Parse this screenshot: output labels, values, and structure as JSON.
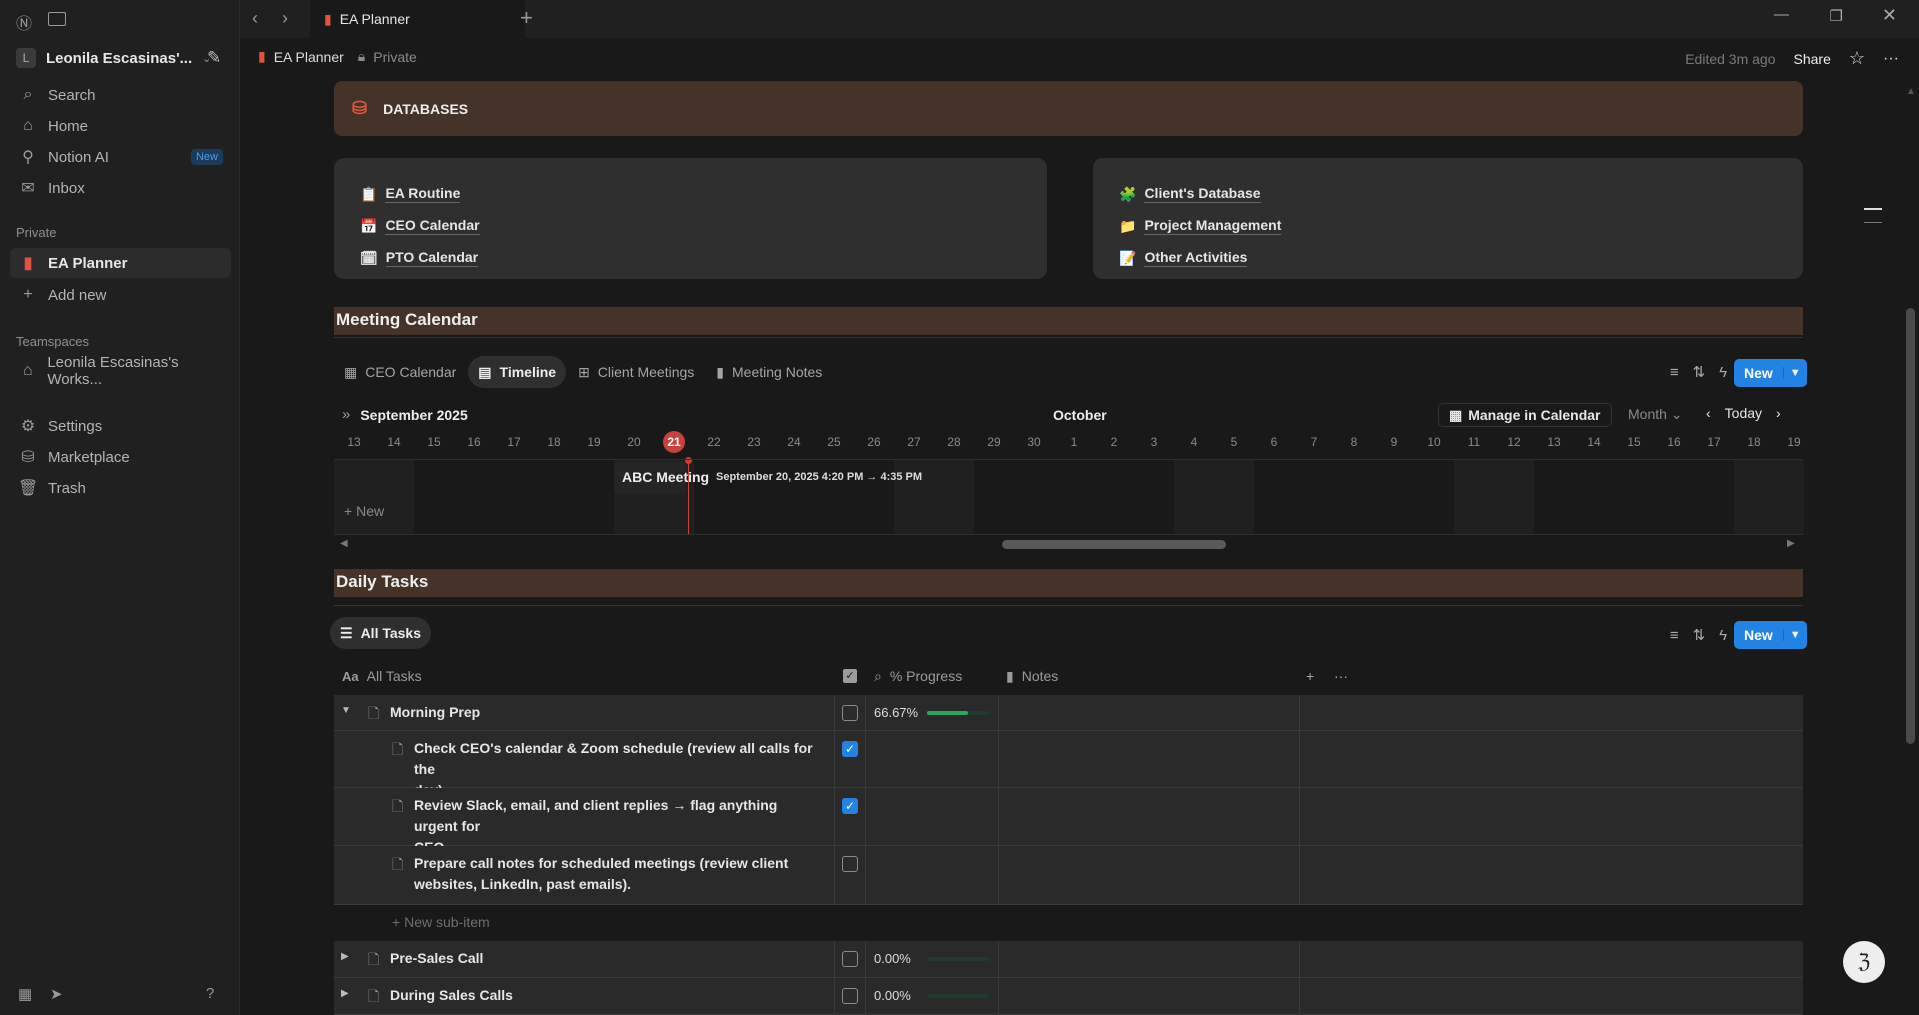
{
  "sidebar": {
    "workspace": "Leonila Escasinas'...",
    "workspace_initial": "L",
    "search": "Search",
    "home": "Home",
    "notion_ai": "Notion AI",
    "new_badge": "New",
    "inbox": "Inbox",
    "private_label": "Private",
    "ea_planner": "EA Planner",
    "add_new": "Add new",
    "teamspaces_label": "Teamspaces",
    "teamspace_item": "Leonila Escasinas's Works...",
    "settings": "Settings",
    "marketplace": "Marketplace",
    "trash": "Trash"
  },
  "tab": {
    "title": "EA Planner"
  },
  "topbar": {
    "breadcrumb": "EA Planner",
    "privacy": "Private",
    "edited": "Edited 3m ago",
    "share": "Share"
  },
  "databases": {
    "title": "DATABASES",
    "left": [
      "EA Routine",
      "CEO Calendar",
      "PTO Calendar"
    ],
    "right": [
      "Client's Database",
      "Project Management",
      "Other Activities"
    ]
  },
  "meeting": {
    "title": "Meeting Calendar",
    "tabs": [
      "CEO Calendar",
      "Timeline",
      "Client Meetings",
      "Meeting Notes"
    ],
    "new": "New",
    "month_label": "September 2025",
    "next_month": "October",
    "manage": "Manage in Calendar",
    "scale": "Month",
    "today": "Today",
    "dates": [
      "13",
      "14",
      "15",
      "16",
      "17",
      "18",
      "19",
      "20",
      "21",
      "22",
      "23",
      "24",
      "25",
      "26",
      "27",
      "28",
      "29",
      "30",
      "1",
      "2",
      "3",
      "4",
      "5",
      "6",
      "7",
      "8",
      "9",
      "10",
      "11",
      "12",
      "13",
      "14",
      "15",
      "16",
      "17",
      "18",
      "19"
    ],
    "today_index": 8,
    "event": {
      "title": "ABC Meeting",
      "time": "September 20, 2025 4:20 PM → 4:35 PM"
    },
    "add_new": "New"
  },
  "tasks": {
    "title": "Daily Tasks",
    "view": "All Tasks",
    "new": "New",
    "columns": {
      "title": "All Tasks",
      "progress": "% Progress",
      "notes": "Notes"
    },
    "rows": [
      {
        "title": "Morning Prep",
        "done": false,
        "progress": "66.67%",
        "progress_value": 0.6667,
        "expanded": true
      },
      {
        "title": "Check CEO's calendar & Zoom schedule (review all calls for the",
        "title2": "day).",
        "done": true,
        "sub": true
      },
      {
        "title": "Review Slack, email, and client replies → flag anything urgent for",
        "title2": "CEO.",
        "done": true,
        "sub": true
      },
      {
        "title": "Prepare call notes for scheduled meetings (review client",
        "title2": "websites, LinkedIn, past emails).",
        "done": false,
        "sub": true
      },
      {
        "title": "Pre-Sales Call",
        "done": false,
        "progress": "0.00%",
        "progress_value": 0
      },
      {
        "title": "During Sales Calls",
        "done": false,
        "progress": "0.00%",
        "progress_value": 0
      }
    ],
    "new_sub_item": "New sub-item"
  }
}
